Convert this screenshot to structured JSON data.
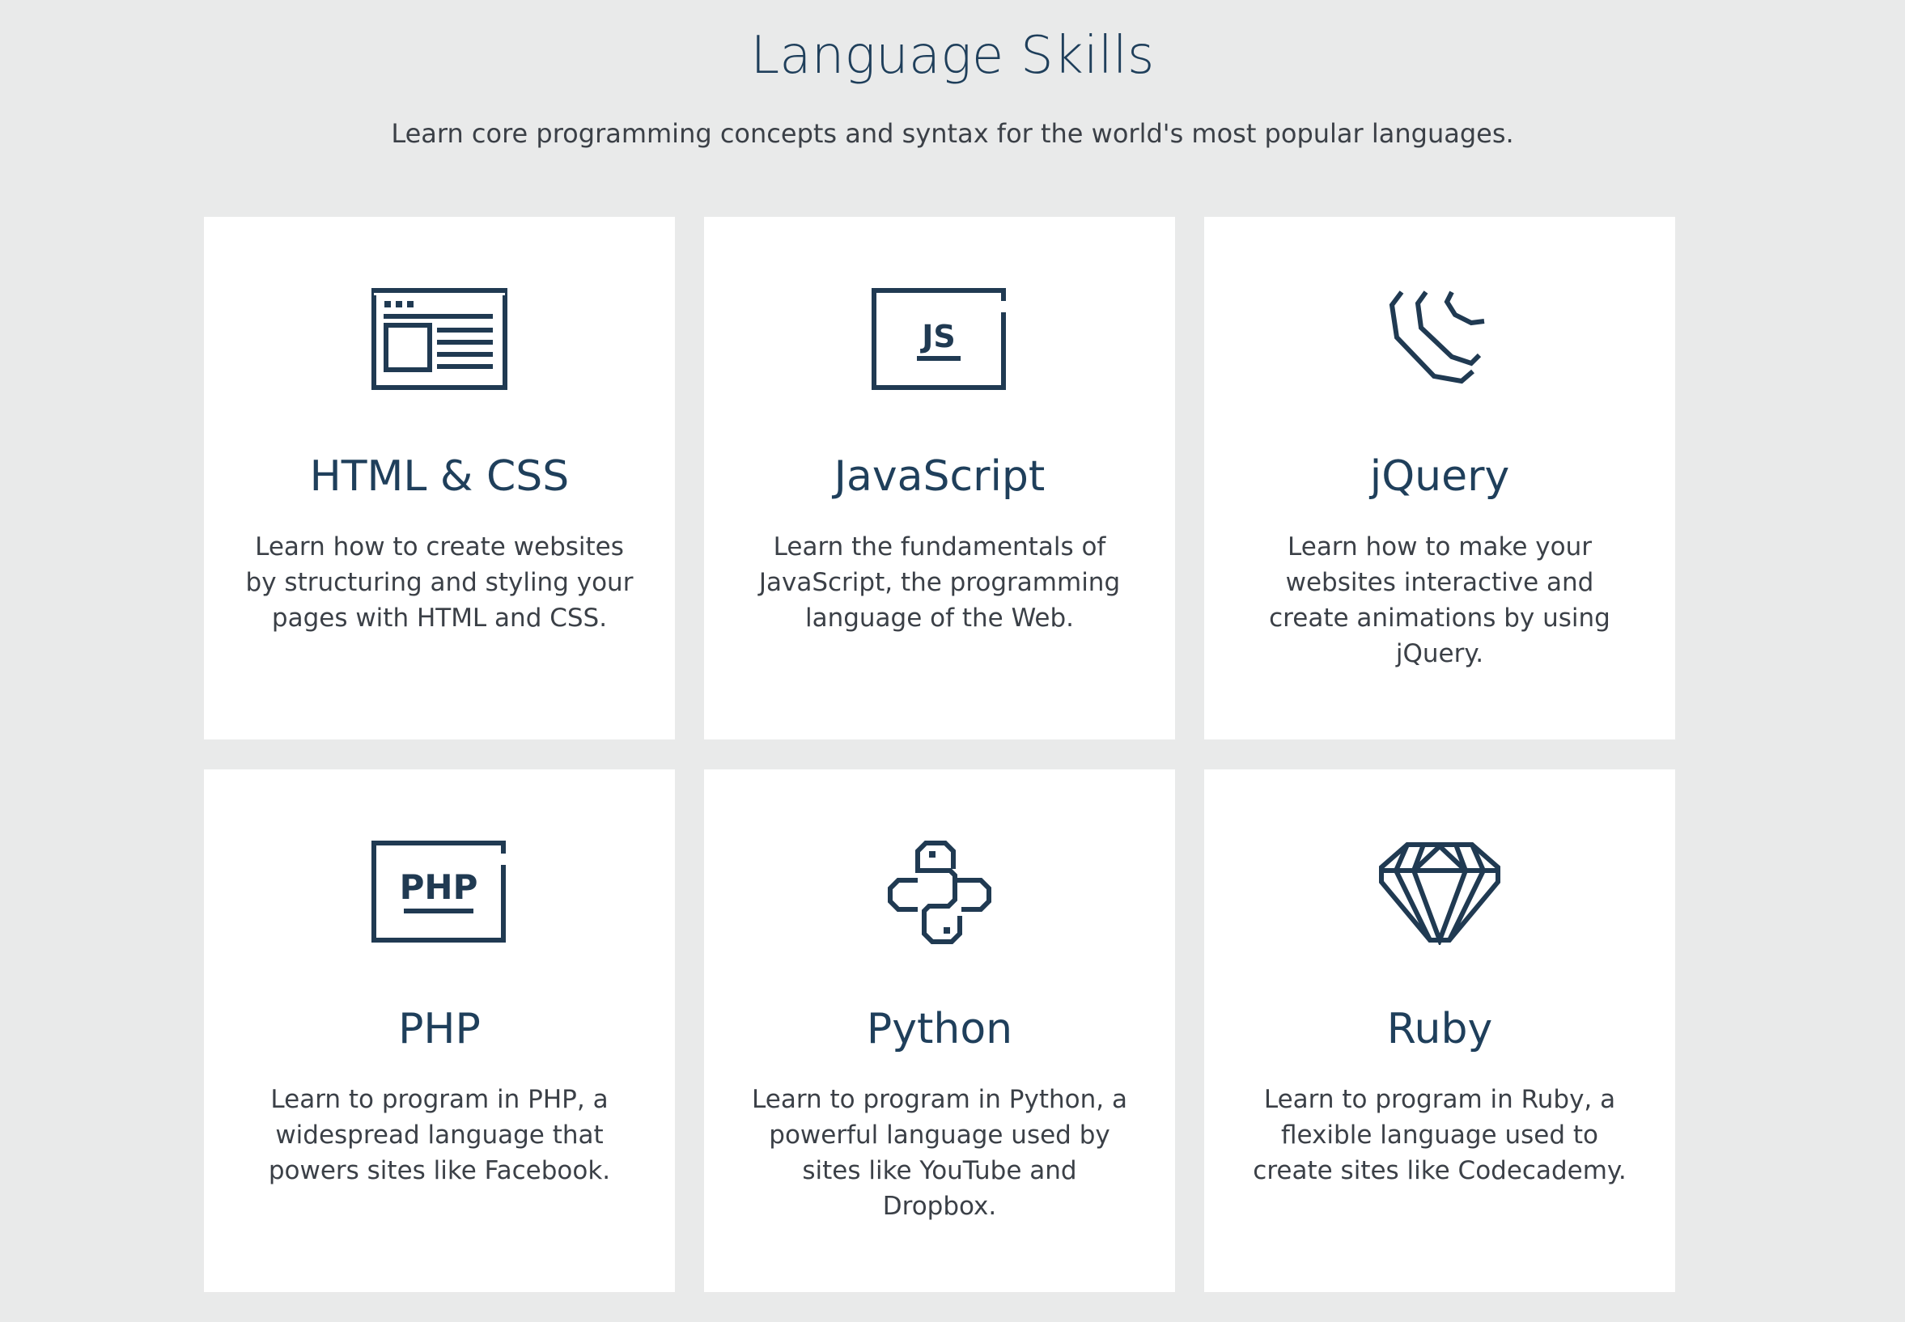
{
  "header": {
    "title": "Language Skills",
    "subtitle": "Learn core programming concepts and syntax for the world's most popular languages."
  },
  "cards": [
    {
      "icon": "browser-window-icon",
      "title": "HTML & CSS",
      "description": "Learn how to create websites by structuring and styling your pages with HTML and CSS."
    },
    {
      "icon": "js-window-icon",
      "icon_text": "JS",
      "title": "JavaScript",
      "description": "Learn the fundamentals of JavaScript, the programming language of the Web."
    },
    {
      "icon": "jquery-icon",
      "title": "jQuery",
      "description": "Learn how to make your websites interactive and create animations by using jQuery."
    },
    {
      "icon": "php-window-icon",
      "icon_text": "PHP",
      "title": "PHP",
      "description": "Learn to program in PHP, a widespread language that powers sites like Facebook."
    },
    {
      "icon": "python-icon",
      "title": "Python",
      "description": "Learn to program in Python, a powerful language used by sites like YouTube and Dropbox."
    },
    {
      "icon": "ruby-gem-icon",
      "title": "Ruby",
      "description": "Learn to program in Ruby, a flexible language used to create sites like Codecademy."
    }
  ],
  "colors": {
    "background": "#e9eaea",
    "card": "#ffffff",
    "heading": "#1f3f5b",
    "icon": "#203a52",
    "body_text": "#3b4047"
  }
}
